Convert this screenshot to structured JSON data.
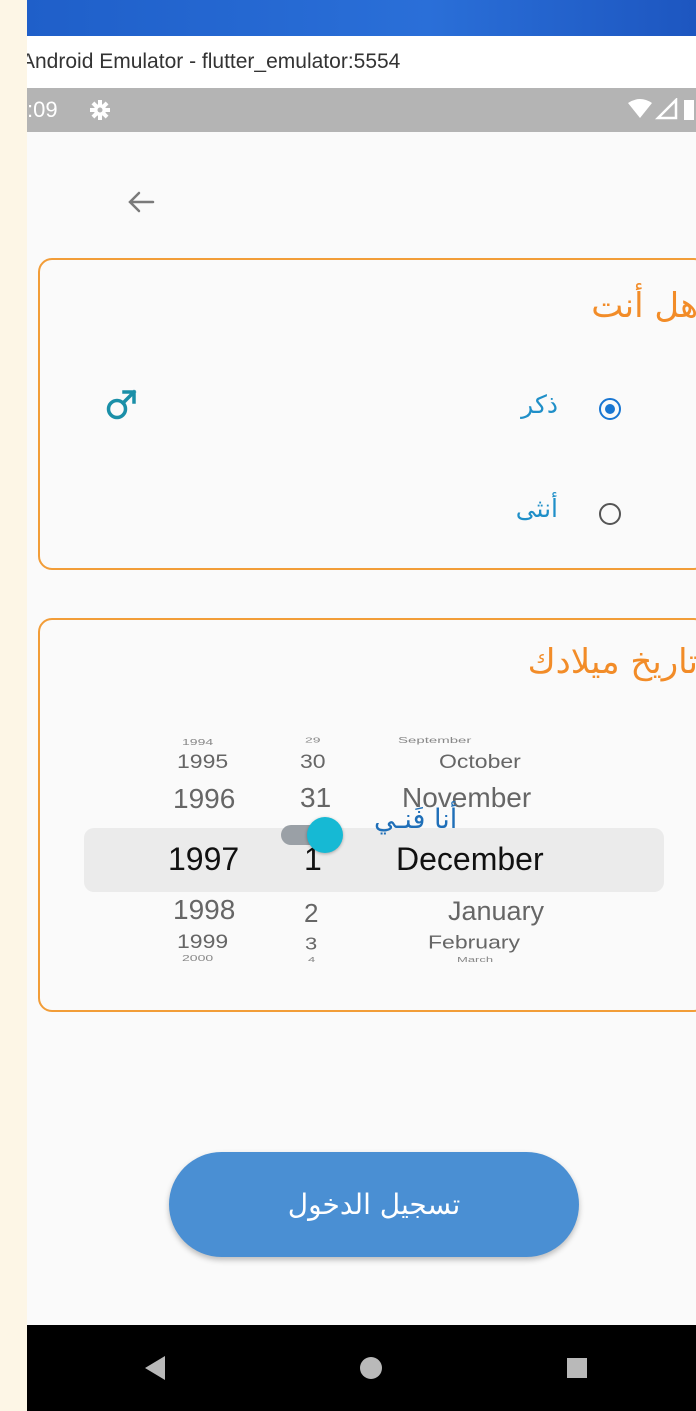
{
  "window": {
    "title": "Android Emulator - flutter_emulator:5554"
  },
  "status_bar": {
    "time": ":09",
    "settings_icon": "gear-icon",
    "wifi_icon": "wifi-icon",
    "signal_icon": "signal-icon",
    "battery_icon": "battery-icon"
  },
  "app": {
    "back_icon": "arrow-left-icon",
    "gender_card": {
      "title": "هل أنت",
      "options": [
        {
          "label": "ذكر",
          "selected": true
        },
        {
          "label": "أنثى",
          "selected": false
        }
      ],
      "gender_icon": "male-symbol-icon"
    },
    "birthdate_card": {
      "title": "تاريخ ميلادك",
      "years": [
        "1994",
        "1995",
        "1996",
        "1997",
        "1998",
        "1999",
        "2000"
      ],
      "days": [
        "29",
        "30",
        "31",
        "1",
        "2",
        "3",
        "4"
      ],
      "months": [
        "September",
        "October",
        "November",
        "December",
        "January",
        "February",
        "March"
      ],
      "selected": {
        "year": "1997",
        "day": "1",
        "month": "December"
      }
    },
    "technician_toggle": {
      "label": "أنا فَنـي",
      "on": true
    },
    "login_button": {
      "label": "تسجيل الدخول"
    }
  },
  "colors": {
    "accent_orange": "#f28c28",
    "radio_blue": "#1976d2",
    "toggle_thumb": "#16b9d4",
    "button_blue": "#4a8fd3"
  }
}
